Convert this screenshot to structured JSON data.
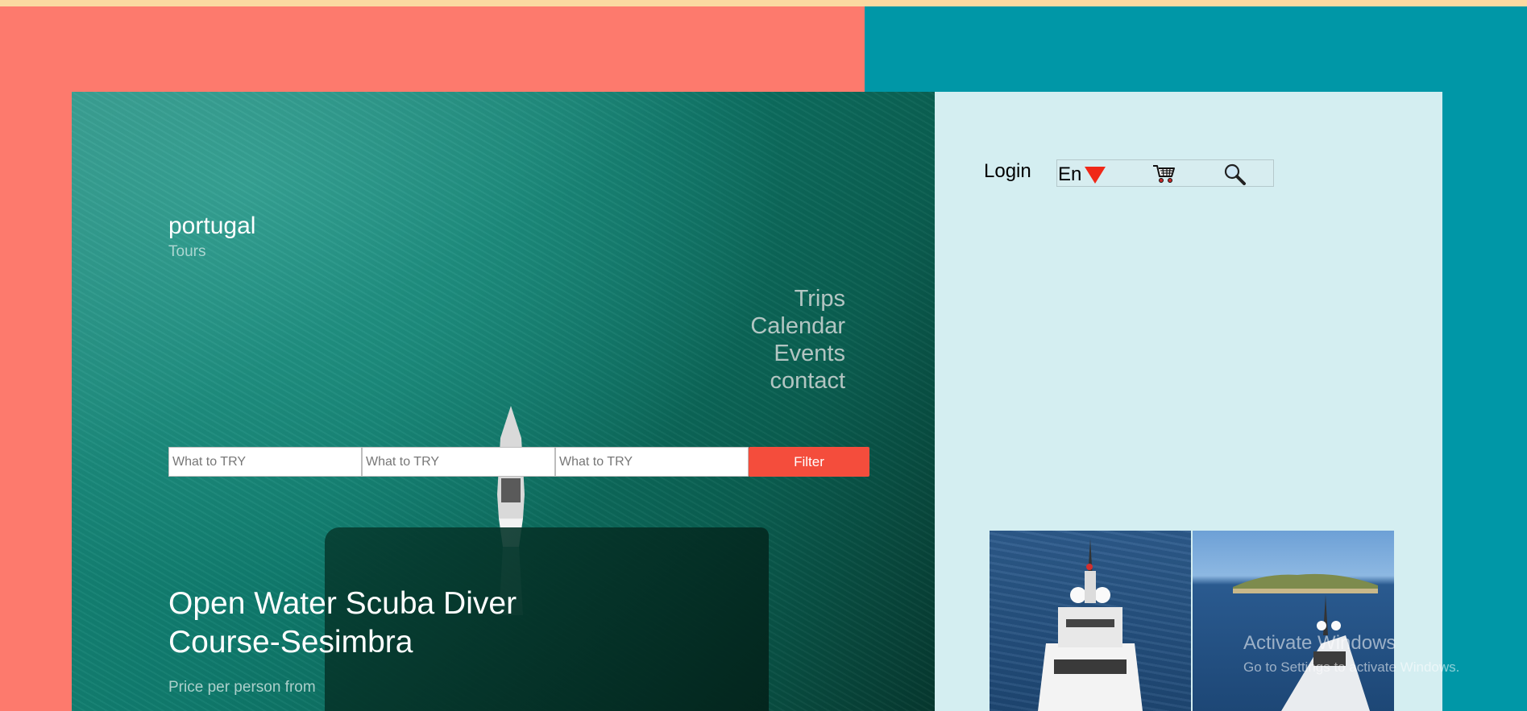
{
  "brand": {
    "title": "portugal",
    "subtitle": "Tours"
  },
  "nav": {
    "items": [
      "Trips",
      "Calendar",
      "Events",
      "contact"
    ]
  },
  "filters": {
    "placeholders": [
      "What to TRY",
      "What to TRY",
      "What to TRY"
    ],
    "button_label": "Filter"
  },
  "hero": {
    "title": "Open Water Scuba Diver Course-Sesimbra",
    "price_label": "Price per person from"
  },
  "header": {
    "login_label": "Login",
    "language": "En",
    "icons": [
      "triangle-down-icon",
      "cart-icon",
      "search-icon"
    ]
  },
  "watermark": {
    "title": "Activate Windows",
    "subtitle": "Go to Settings to activate Windows."
  },
  "colors": {
    "top_strip": "#fbd9a1",
    "left_background": "#fd7a6d",
    "right_background": "#0097a7",
    "side_panel": "#d4eef1",
    "filter_button": "#f44d3c",
    "language_arrow": "#f02818"
  }
}
